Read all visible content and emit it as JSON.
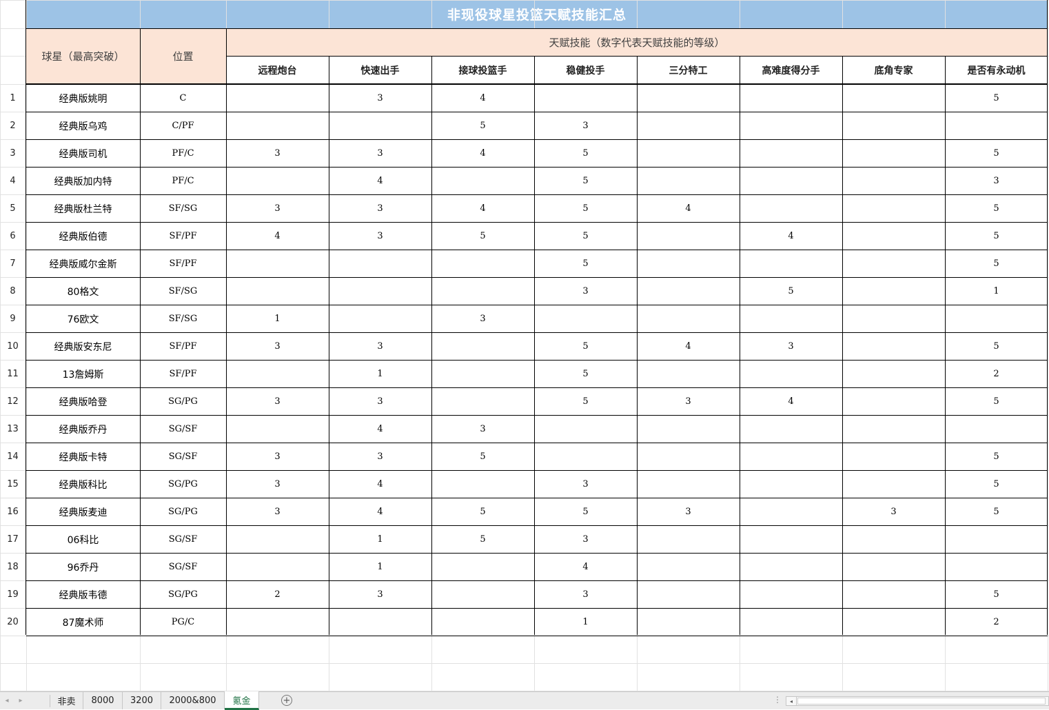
{
  "sheet": {
    "title": "非现役球星投篮天赋技能汇总",
    "col_player_header": "球星（最高突破）",
    "col_position_header": "位置",
    "talent_group_header": "天赋技能（数字代表天赋技能的等级）",
    "talent_columns": [
      "远程炮台",
      "快速出手",
      "接球投篮手",
      "稳健投手",
      "三分特工",
      "高难度得分手",
      "底角专家",
      "是否有永动机"
    ],
    "rows": [
      {
        "num": "1",
        "name": "经典版姚明",
        "pos": "C",
        "vals": [
          "",
          "3",
          "4",
          "",
          "",
          "",
          "",
          "5"
        ]
      },
      {
        "num": "2",
        "name": "经典版乌鸡",
        "pos": "C/PF",
        "vals": [
          "",
          "",
          "5",
          "3",
          "",
          "",
          "",
          ""
        ]
      },
      {
        "num": "3",
        "name": "经典版司机",
        "pos": "PF/C",
        "vals": [
          "3",
          "3",
          "4",
          "5",
          "",
          "",
          "",
          "5"
        ]
      },
      {
        "num": "4",
        "name": "经典版加内特",
        "pos": "PF/C",
        "vals": [
          "",
          "4",
          "",
          "5",
          "",
          "",
          "",
          "3"
        ]
      },
      {
        "num": "5",
        "name": "经典版杜兰特",
        "pos": "SF/SG",
        "vals": [
          "3",
          "3",
          "4",
          "5",
          "4",
          "",
          "",
          "5"
        ]
      },
      {
        "num": "6",
        "name": "经典版伯德",
        "pos": "SF/PF",
        "vals": [
          "4",
          "3",
          "5",
          "5",
          "",
          "4",
          "",
          "5"
        ]
      },
      {
        "num": "7",
        "name": "经典版威尔金斯",
        "pos": "SF/PF",
        "vals": [
          "",
          "",
          "",
          "5",
          "",
          "",
          "",
          "5"
        ]
      },
      {
        "num": "8",
        "name": "80格文",
        "pos": "SF/SG",
        "vals": [
          "",
          "",
          "",
          "3",
          "",
          "5",
          "",
          "1"
        ]
      },
      {
        "num": "9",
        "name": "76欧文",
        "pos": "SF/SG",
        "vals": [
          "1",
          "",
          "3",
          "",
          "",
          "",
          "",
          ""
        ]
      },
      {
        "num": "10",
        "name": "经典版安东尼",
        "pos": "SF/PF",
        "vals": [
          "3",
          "3",
          "",
          "5",
          "4",
          "3",
          "",
          "5"
        ]
      },
      {
        "num": "11",
        "name": "13詹姆斯",
        "pos": "SF/PF",
        "vals": [
          "",
          "1",
          "",
          "5",
          "",
          "",
          "",
          "2"
        ]
      },
      {
        "num": "12",
        "name": "经典版哈登",
        "pos": "SG/PG",
        "vals": [
          "3",
          "3",
          "",
          "5",
          "3",
          "4",
          "",
          "5"
        ]
      },
      {
        "num": "13",
        "name": "经典版乔丹",
        "pos": "SG/SF",
        "vals": [
          "",
          "4",
          "3",
          "",
          "",
          "",
          "",
          ""
        ]
      },
      {
        "num": "14",
        "name": "经典版卡特",
        "pos": "SG/SF",
        "vals": [
          "3",
          "3",
          "5",
          "",
          "",
          "",
          "",
          "5"
        ]
      },
      {
        "num": "15",
        "name": "经典版科比",
        "pos": "SG/PG",
        "vals": [
          "3",
          "4",
          "",
          "3",
          "",
          "",
          "",
          "5"
        ]
      },
      {
        "num": "16",
        "name": "经典版麦迪",
        "pos": "SG/PG",
        "vals": [
          "3",
          "4",
          "5",
          "5",
          "3",
          "",
          "3",
          "5"
        ]
      },
      {
        "num": "17",
        "name": "06科比",
        "pos": "SG/SF",
        "vals": [
          "",
          "1",
          "5",
          "3",
          "",
          "",
          "",
          ""
        ]
      },
      {
        "num": "18",
        "name": "96乔丹",
        "pos": "SG/SF",
        "vals": [
          "",
          "1",
          "",
          "4",
          "",
          "",
          "",
          ""
        ]
      },
      {
        "num": "19",
        "name": "经典版韦德",
        "pos": "SG/PG",
        "vals": [
          "2",
          "3",
          "",
          "3",
          "",
          "",
          "",
          "5"
        ]
      },
      {
        "num": "20",
        "name": "87魔术师",
        "pos": "PG/C",
        "vals": [
          "",
          "",
          "",
          "1",
          "",
          "",
          "",
          "2"
        ]
      }
    ]
  },
  "tabs": {
    "items": [
      {
        "label": "非卖",
        "active": false
      },
      {
        "label": "8000",
        "active": false
      },
      {
        "label": "3200",
        "active": false
      },
      {
        "label": "2000&800",
        "active": false
      },
      {
        "label": "氪金",
        "active": true
      }
    ],
    "add_icon": "+",
    "nav_prev_icon": "◂",
    "nav_next_icon": "▸",
    "more_icon": "⋮",
    "scroll_left_icon": "◂"
  },
  "colors": {
    "title_bar": "#9dc3e6",
    "header_fill": "#fce4d6",
    "active_tab": "#217346",
    "gridline": "#e1e1e1"
  }
}
